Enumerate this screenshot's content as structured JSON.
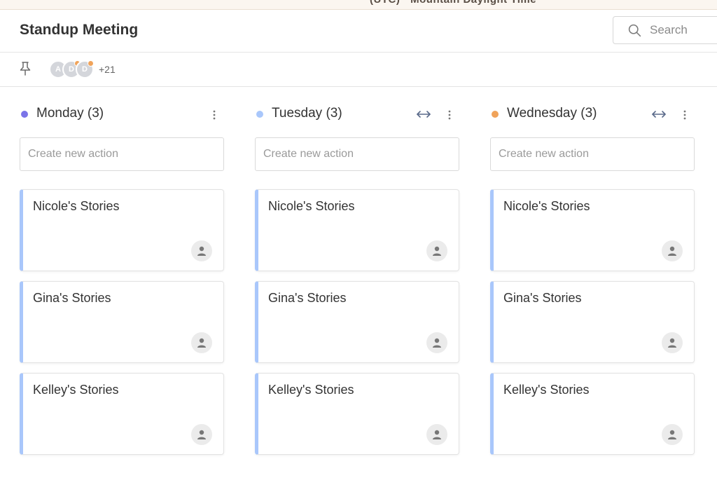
{
  "banner": {
    "text": "(UTC) · Mountain Daylight Time"
  },
  "header": {
    "title": "Standup Meeting",
    "search": {
      "placeholder": "Search"
    }
  },
  "subbar": {
    "avatars": [
      "A",
      "D",
      "D"
    ],
    "extra_count": "+21"
  },
  "colors": {
    "monday": "#7b74e8",
    "tuesday": "#a9c7fb",
    "wednesday": "#f0a35a",
    "card_accent": "#a9c7fb"
  },
  "columns": [
    {
      "title": "Monday (3)",
      "create_placeholder": "Create new action",
      "cards": [
        {
          "title": "Nicole's Stories"
        },
        {
          "title": "Gina's Stories"
        },
        {
          "title": "Kelley's Stories"
        }
      ]
    },
    {
      "title": "Tuesday (3)",
      "create_placeholder": "Create new action",
      "cards": [
        {
          "title": "Nicole's Stories"
        },
        {
          "title": "Gina's Stories"
        },
        {
          "title": "Kelley's Stories"
        }
      ]
    },
    {
      "title": "Wednesday (3)",
      "create_placeholder": "Create new action",
      "cards": [
        {
          "title": "Nicole's Stories"
        },
        {
          "title": "Gina's Stories"
        },
        {
          "title": "Kelley's Stories"
        }
      ]
    }
  ],
  "icons": {
    "search": "search-icon",
    "pin": "pin-icon",
    "resize": "resize-horizontal-icon",
    "menu": "more-vertical-icon",
    "user": "user-icon"
  }
}
